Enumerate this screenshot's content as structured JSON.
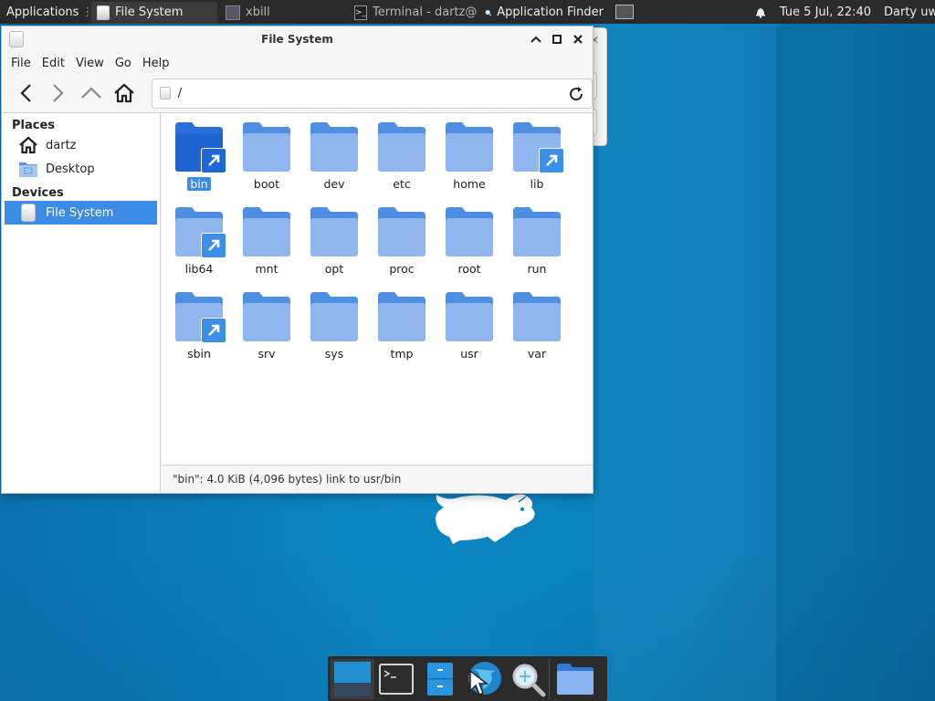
{
  "top_panel": {
    "applications_label": "Applications",
    "tasks": [
      {
        "label": "File System",
        "icon": "drive-icon"
      },
      {
        "label": "xbill",
        "icon": "xbill-icon"
      },
      {
        "label": "Terminal - dartz@...",
        "icon": "terminal-icon"
      },
      {
        "label": "Application Finder",
        "icon": "search-icon"
      }
    ],
    "clock": "Tue  5 Jul, 22:40",
    "user": "Darty uwu"
  },
  "window": {
    "title": "File System",
    "menu": [
      "File",
      "Edit",
      "View",
      "Go",
      "Help"
    ],
    "location_path": "/",
    "sidebar": {
      "places_header": "Places",
      "places": [
        {
          "label": "dartz",
          "icon": "home-icon"
        },
        {
          "label": "Desktop",
          "icon": "desktop-icon"
        }
      ],
      "devices_header": "Devices",
      "devices": [
        {
          "label": "File System",
          "icon": "drive-icon",
          "selected": true
        }
      ]
    },
    "folders": [
      {
        "name": "bin",
        "link": true,
        "selected": true
      },
      {
        "name": "boot",
        "link": false
      },
      {
        "name": "dev",
        "link": false
      },
      {
        "name": "etc",
        "link": false
      },
      {
        "name": "home",
        "link": false
      },
      {
        "name": "lib",
        "link": true
      },
      {
        "name": "lib64",
        "link": true
      },
      {
        "name": "mnt",
        "link": false
      },
      {
        "name": "opt",
        "link": false
      },
      {
        "name": "proc",
        "link": false
      },
      {
        "name": "root",
        "link": false
      },
      {
        "name": "run",
        "link": false
      },
      {
        "name": "sbin",
        "link": true
      },
      {
        "name": "srv",
        "link": false
      },
      {
        "name": "sys",
        "link": false
      },
      {
        "name": "tmp",
        "link": false
      },
      {
        "name": "usr",
        "link": false
      },
      {
        "name": "var",
        "link": false
      }
    ],
    "status": "\"bin\": 4.0 KiB (4,096 bytes) link to usr/bin"
  },
  "dock": [
    {
      "name": "show-desktop",
      "icon": "show-desktop-icon"
    },
    {
      "name": "terminal",
      "icon": "terminal-icon"
    },
    {
      "name": "file-manager",
      "icon": "file-manager-icon"
    },
    {
      "name": "web-browser",
      "icon": "web-browser-icon"
    },
    {
      "name": "app-finder",
      "icon": "search-icon"
    },
    {
      "name": "home-folder",
      "icon": "folder-icon"
    }
  ],
  "colors": {
    "accent": "#3c8ce7",
    "folder_light": "#8fb6ee",
    "folder_dark": "#2a6fd8",
    "panel": "#2b2b2b",
    "desktop": "#0b86c3"
  }
}
